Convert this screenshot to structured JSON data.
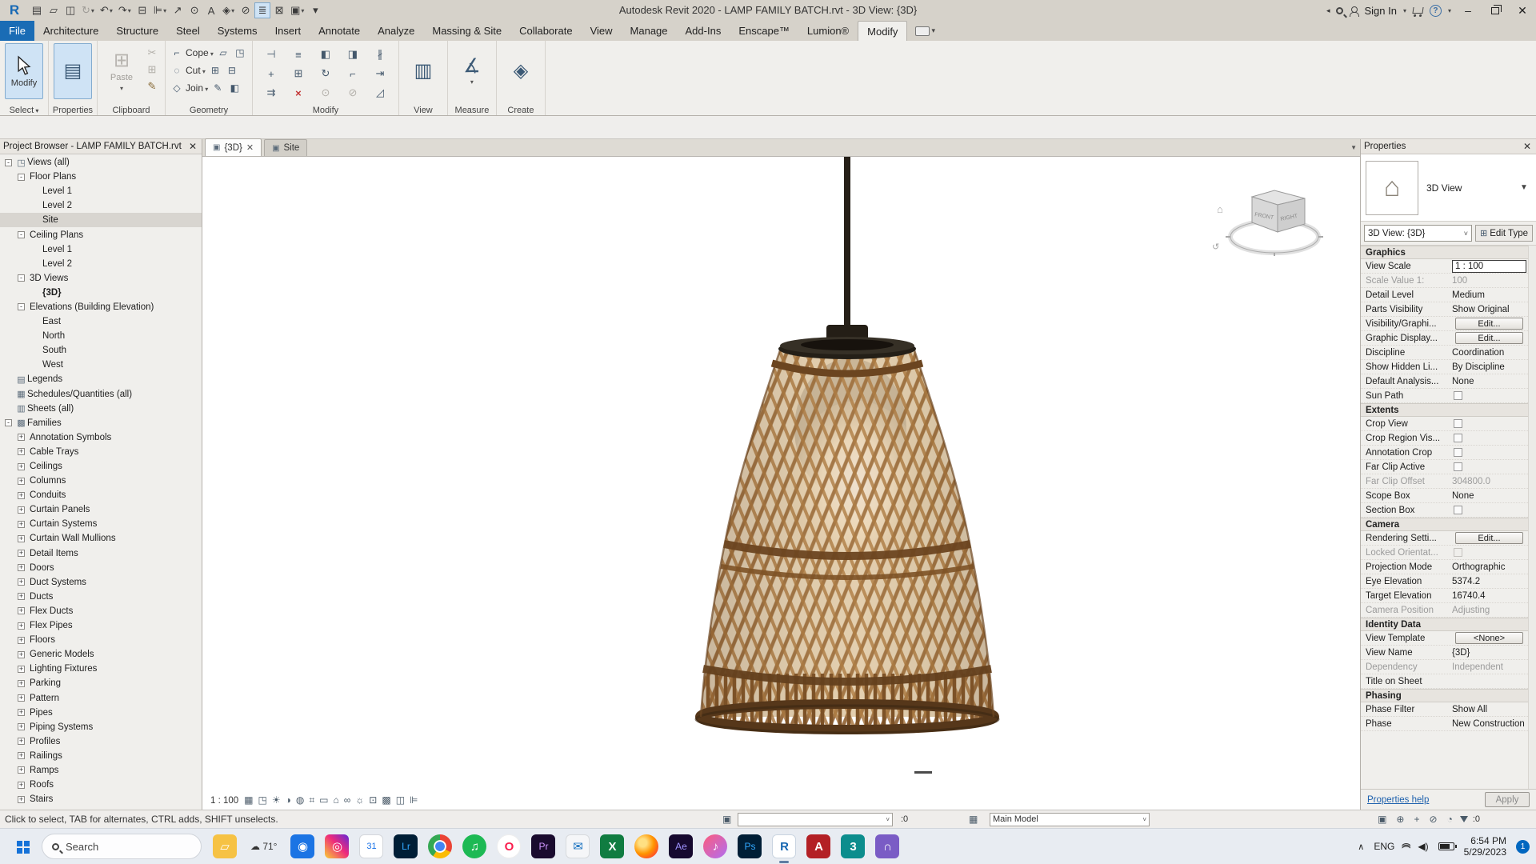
{
  "titlebar": {
    "title": "Autodesk Revit 2020 - LAMP FAMILY BATCH.rvt - 3D View: {3D}",
    "sign_in": "Sign In",
    "help_glyph": "?",
    "min_glyph": "–",
    "close_glyph": "✕",
    "overflow_glyph": "◂",
    "qat": [
      {
        "name": "app-menu-icon",
        "g": "▤"
      },
      {
        "name": "open-icon",
        "g": "▱"
      },
      {
        "name": "save-icon",
        "g": "◫"
      },
      {
        "name": "sync-with-central-icon",
        "g": "↻",
        "cls": "dd dim"
      },
      {
        "name": "undo-icon",
        "g": "↶",
        "cls": "dd"
      },
      {
        "name": "redo-icon",
        "g": "↷",
        "cls": "dd"
      },
      {
        "name": "print-icon",
        "g": "⊟"
      },
      {
        "name": "measure-icon",
        "g": "⊫",
        "cls": "dd"
      },
      {
        "name": "aligned-dimension-icon",
        "g": "↗"
      },
      {
        "name": "tag-icon",
        "g": "⊙"
      },
      {
        "name": "text-icon",
        "g": "A"
      },
      {
        "name": "default-3d-view-icon",
        "g": "◈",
        "cls": "dd"
      },
      {
        "name": "section-icon",
        "g": "⊘"
      },
      {
        "name": "thin-lines-icon",
        "g": "≣",
        "cls": "on"
      },
      {
        "name": "close-inactive-windows-icon",
        "g": "⊠"
      },
      {
        "name": "switch-windows-icon",
        "g": "▣",
        "cls": "dd"
      },
      {
        "name": "customize-qat-icon",
        "g": "▾"
      }
    ]
  },
  "ribbon": {
    "tabs": [
      {
        "label": "File",
        "cls": "file"
      },
      {
        "label": "Architecture"
      },
      {
        "label": "Structure"
      },
      {
        "label": "Steel"
      },
      {
        "label": "Systems"
      },
      {
        "label": "Insert"
      },
      {
        "label": "Annotate"
      },
      {
        "label": "Analyze"
      },
      {
        "label": "Massing & Site"
      },
      {
        "label": "Collaborate"
      },
      {
        "label": "View"
      },
      {
        "label": "Manage"
      },
      {
        "label": "Add-Ins"
      },
      {
        "label": "Enscape™"
      },
      {
        "label": "Lumion®"
      },
      {
        "label": "Modify",
        "cls": "active"
      }
    ],
    "panels": {
      "select": "Select",
      "properties": "Properties",
      "clipboard": "Clipboard",
      "geometry": "Geometry",
      "modify": "Modify",
      "view": "View",
      "measure": "Measure",
      "create": "Create"
    },
    "modify_button": "Modify",
    "paste_label": "Paste",
    "properties_icon": "▤",
    "view_icon": "▥",
    "measure_icon": "∡",
    "create_icon": "◈",
    "clipboard_icons": [
      {
        "name": "cut-icon",
        "g": "✂",
        "cls": "dim"
      },
      {
        "name": "copy-to-clipboard-icon",
        "g": "⊞",
        "cls": "dim"
      },
      {
        "name": "match-type-properties-icon",
        "g": "✎",
        "cls": "brown"
      }
    ],
    "geometry_rows": [
      {
        "name": "cope-button",
        "g": "⌐",
        "label": "Cope",
        "x1": "▱",
        "x2": "◳"
      },
      {
        "name": "cut-geometry-button",
        "g": "◌",
        "label": "Cut",
        "x1": "⊞",
        "x2": "⊟"
      },
      {
        "name": "join-geometry-button",
        "g": "◇",
        "label": "Join",
        "x1": "✎",
        "x2": "◧"
      }
    ],
    "modify_icons": [
      {
        "name": "align-icon",
        "g": "⊣"
      },
      {
        "name": "offset-icon",
        "g": "≡"
      },
      {
        "name": "mirror-pick-axis-icon",
        "g": "◧"
      },
      {
        "name": "mirror-draw-axis-icon",
        "g": "◨"
      },
      {
        "name": "split-element-icon",
        "g": "∦"
      },
      {
        "name": "move-icon",
        "g": "+"
      },
      {
        "name": "copy-icon",
        "g": "⊞"
      },
      {
        "name": "rotate-icon",
        "g": "↻"
      },
      {
        "name": "trim-corner-icon",
        "g": "⌐"
      },
      {
        "name": "trim-extend-single-icon",
        "g": "⇥"
      },
      {
        "name": "trim-extend-multiple-icon",
        "g": "⇉"
      },
      {
        "name": "delete-icon",
        "g": "×",
        "cls": "red"
      },
      {
        "name": "pin-icon",
        "g": "⊙",
        "cls": "dim"
      },
      {
        "name": "unpin-icon",
        "g": "⊘",
        "cls": "dim"
      },
      {
        "name": "scale-icon",
        "g": "◿"
      }
    ]
  },
  "browser": {
    "title": "Project Browser - LAMP FAMILY BATCH.rvt",
    "close_glyph": "✕",
    "tree": [
      {
        "label": "Views (all)",
        "lv": 0,
        "exp": "-",
        "ico": "◳"
      },
      {
        "label": "Floor Plans",
        "lv": 1,
        "exp": "-"
      },
      {
        "label": "Level 1",
        "lv": 2
      },
      {
        "label": "Level 2",
        "lv": 2
      },
      {
        "label": "Site",
        "lv": 2,
        "cls": "sel"
      },
      {
        "label": "Ceiling Plans",
        "lv": 1,
        "exp": "-"
      },
      {
        "label": "Level 1",
        "lv": 2
      },
      {
        "label": "Level 2",
        "lv": 2
      },
      {
        "label": "3D Views",
        "lv": 1,
        "exp": "-"
      },
      {
        "label": "{3D}",
        "lv": 2,
        "cls": "bold"
      },
      {
        "label": "Elevations (Building Elevation)",
        "lv": 1,
        "exp": "-"
      },
      {
        "label": "East",
        "lv": 2
      },
      {
        "label": "North",
        "lv": 2
      },
      {
        "label": "South",
        "lv": 2
      },
      {
        "label": "West",
        "lv": 2
      },
      {
        "label": "Legends",
        "lv": 0,
        "ico": "▤"
      },
      {
        "label": "Schedules/Quantities (all)",
        "lv": 0,
        "ico": "▦"
      },
      {
        "label": "Sheets (all)",
        "lv": 0,
        "ico": "▥"
      },
      {
        "label": "Families",
        "lv": 0,
        "exp": "-",
        "ico": "▩"
      },
      {
        "label": "Annotation Symbols",
        "lv": 1,
        "exp": "+"
      },
      {
        "label": "Cable Trays",
        "lv": 1,
        "exp": "+"
      },
      {
        "label": "Ceilings",
        "lv": 1,
        "exp": "+"
      },
      {
        "label": "Columns",
        "lv": 1,
        "exp": "+"
      },
      {
        "label": "Conduits",
        "lv": 1,
        "exp": "+"
      },
      {
        "label": "Curtain Panels",
        "lv": 1,
        "exp": "+"
      },
      {
        "label": "Curtain Systems",
        "lv": 1,
        "exp": "+"
      },
      {
        "label": "Curtain Wall Mullions",
        "lv": 1,
        "exp": "+"
      },
      {
        "label": "Detail Items",
        "lv": 1,
        "exp": "+"
      },
      {
        "label": "Doors",
        "lv": 1,
        "exp": "+"
      },
      {
        "label": "Duct Systems",
        "lv": 1,
        "exp": "+"
      },
      {
        "label": "Ducts",
        "lv": 1,
        "exp": "+"
      },
      {
        "label": "Flex Ducts",
        "lv": 1,
        "exp": "+"
      },
      {
        "label": "Flex Pipes",
        "lv": 1,
        "exp": "+"
      },
      {
        "label": "Floors",
        "lv": 1,
        "exp": "+"
      },
      {
        "label": "Generic Models",
        "lv": 1,
        "exp": "+"
      },
      {
        "label": "Lighting Fixtures",
        "lv": 1,
        "exp": "+"
      },
      {
        "label": "Parking",
        "lv": 1,
        "exp": "+"
      },
      {
        "label": "Pattern",
        "lv": 1,
        "exp": "+"
      },
      {
        "label": "Pipes",
        "lv": 1,
        "exp": "+"
      },
      {
        "label": "Piping Systems",
        "lv": 1,
        "exp": "+"
      },
      {
        "label": "Profiles",
        "lv": 1,
        "exp": "+"
      },
      {
        "label": "Railings",
        "lv": 1,
        "exp": "+"
      },
      {
        "label": "Ramps",
        "lv": 1,
        "exp": "+"
      },
      {
        "label": "Roofs",
        "lv": 1,
        "exp": "+"
      },
      {
        "label": "Stairs",
        "lv": 1,
        "exp": "+"
      }
    ]
  },
  "view_tabs": {
    "tabs": [
      {
        "label": "{3D}",
        "cls": "active",
        "x": "✕",
        "ico": "▣"
      },
      {
        "label": "Site",
        "ico": "▣"
      }
    ],
    "list_icon": "▼"
  },
  "properties": {
    "title": "Properties",
    "close_glyph": "✕",
    "preview_icon": "⌂",
    "view_type": "3D View",
    "type_selector": "3D View: {3D}",
    "edit_type": "Edit Type",
    "edit_type_icon": "⊞",
    "rows": [
      {
        "label": "Graphics",
        "cls": "sec"
      },
      {
        "label": "View Scale",
        "value": "1 : 100",
        "cls": "input"
      },
      {
        "label": "Scale Value    1:",
        "value": "100",
        "cls": "dis"
      },
      {
        "label": "Detail Level",
        "value": "Medium"
      },
      {
        "label": "Parts Visibility",
        "value": "Show Original"
      },
      {
        "label": "Visibility/Graphi...",
        "value": "Edit...",
        "cls": "btn"
      },
      {
        "label": "Graphic Display...",
        "value": "Edit...",
        "cls": "btn"
      },
      {
        "label": "Discipline",
        "value": "Coordination"
      },
      {
        "label": "Show Hidden Li...",
        "value": "By Discipline"
      },
      {
        "label": "Default Analysis...",
        "value": "None"
      },
      {
        "label": "Sun Path",
        "cls": "check"
      },
      {
        "label": "Extents",
        "cls": "sec"
      },
      {
        "label": "Crop View",
        "cls": "check"
      },
      {
        "label": "Crop Region Vis...",
        "cls": "check"
      },
      {
        "label": "Annotation Crop",
        "cls": "check"
      },
      {
        "label": "Far Clip Active",
        "cls": "check"
      },
      {
        "label": "Far Clip Offset",
        "value": "304800.0",
        "cls": "dis"
      },
      {
        "label": "Scope Box",
        "value": "None"
      },
      {
        "label": "Section Box",
        "cls": "check"
      },
      {
        "label": "Camera",
        "cls": "sec"
      },
      {
        "label": "Rendering Setti...",
        "value": "Edit...",
        "cls": "btn"
      },
      {
        "label": "Locked Orientat...",
        "cls": "check dis"
      },
      {
        "label": "Projection Mode",
        "value": "Orthographic"
      },
      {
        "label": "Eye Elevation",
        "value": "5374.2"
      },
      {
        "label": "Target Elevation",
        "value": "16740.4"
      },
      {
        "label": "Camera Position",
        "value": "Adjusting",
        "cls": "dis"
      },
      {
        "label": "Identity Data",
        "cls": "sec"
      },
      {
        "label": "View Template",
        "value": "<None>",
        "cls": "btn"
      },
      {
        "label": "View Name",
        "value": "{3D}"
      },
      {
        "label": "Dependency",
        "value": "Independent",
        "cls": "dis"
      },
      {
        "label": "Title on Sheet",
        "value": ""
      },
      {
        "label": "Phasing",
        "cls": "sec"
      },
      {
        "label": "Phase Filter",
        "value": "Show All"
      },
      {
        "label": "Phase",
        "value": "New Construction"
      }
    ],
    "help": "Properties help",
    "apply": "Apply"
  },
  "viewbar": {
    "scale": "1 : 100",
    "icons": [
      {
        "name": "visual-style-icon",
        "g": "▦"
      },
      {
        "name": "detail-level-icon",
        "g": "◳"
      },
      {
        "name": "sun-path-icon",
        "g": "☀"
      },
      {
        "name": "shadows-icon",
        "g": "◑"
      },
      {
        "name": "render-dialog-icon",
        "g": "◍"
      },
      {
        "name": "crop-view-icon",
        "g": "⌗"
      },
      {
        "name": "show-crop-region-icon",
        "g": "▭"
      },
      {
        "name": "locked-3d-view-icon",
        "g": "⌂"
      },
      {
        "name": "reveal-hidden-elements-icon",
        "g": "∞"
      },
      {
        "name": "temporary-hide-isolate-icon",
        "g": "☼"
      },
      {
        "name": "temporary-view-properties-icon",
        "g": "⊡"
      },
      {
        "name": "worksharing-display-icon",
        "g": "▩"
      },
      {
        "name": "displaced-elements-icon",
        "g": "◫"
      },
      {
        "name": "measure-constraints-icon",
        "g": "⊫"
      }
    ]
  },
  "statusbar": {
    "hint": "Click to select, TAB for alternates, CTRL adds, SHIFT unselects.",
    "workset_icon": "▣",
    "requests": ":0",
    "design_icon": "▦",
    "main_model": "Main Model",
    "right_icons": [
      {
        "name": "editable-only-icon",
        "g": "▣"
      },
      {
        "name": "links-icon",
        "g": "⊕"
      },
      {
        "name": "press-drag-icon",
        "g": "+"
      },
      {
        "name": "exclude-options-icon",
        "g": "⊘"
      },
      {
        "name": "background-processes-icon",
        "g": "◔"
      }
    ],
    "filter_count": ":0"
  },
  "canvas": {
    "viewcube_front": "FRONT",
    "viewcube_right": "RIGHT"
  },
  "taskbar": {
    "search": "Search",
    "lang": "ENG",
    "time": "6:54 PM",
    "date": "5/29/2023",
    "badge": "1",
    "apps": [
      {
        "name": "file-explorer-icon",
        "g": "▱",
        "style": "background:#f6c244;color:#fff"
      },
      {
        "name": "weather-widget",
        "g": "☁ 71°",
        "style": "background:transparent;color:#333;font-size:12px;width:auto;padding:0 4px"
      },
      {
        "name": "camera-app-icon",
        "g": "◉",
        "style": "background:#1b74e4;color:#fff"
      },
      {
        "name": "instagram-icon",
        "g": "◎",
        "style": "background:linear-gradient(45deg,#f9ce34,#ee2a7b 55%,#6228d7);color:#fff"
      },
      {
        "name": "calendar-app-icon",
        "g": "31",
        "style": "background:#fff;color:#1a73e8;font-size:11px;border:1px solid #d4d7dc"
      },
      {
        "name": "lightroom-icon",
        "g": "Lr",
        "style": "background:#001e36;color:#31a8ff;font-size:12px"
      },
      {
        "name": "chrome-icon",
        "g": "",
        "style": "background:radial-gradient(circle,#4285f4 0 27%,#fff 29% 36%,transparent 38%),conic-gradient(#ea4335 0 33%,#fbbc05 33% 60%,#34a853 60% 100%);border-radius:50%"
      },
      {
        "name": "spotify-icon",
        "g": "♫",
        "style": "background:#1db954;color:#fff;border-radius:50%"
      },
      {
        "name": "opera-icon",
        "g": "O",
        "style": "background:#fff;color:#fa1e4e;font-weight:bold;border-radius:50%;border:1px solid #eee"
      },
      {
        "name": "premiere-icon",
        "g": "Pr",
        "style": "background:#1a0b2e;color:#cf96fd;font-size:12px"
      },
      {
        "name": "mail-app-icon",
        "g": "✉",
        "style": "background:#f5f6f8;color:#0f6cbd;border:1px solid #d8dadd"
      },
      {
        "name": "excel-icon",
        "g": "X",
        "style": "background:#107c41;color:#fff;font-weight:bold"
      },
      {
        "name": "firefox-icon",
        "g": "",
        "style": "background:radial-gradient(circle at 35% 35%,#ffe082 0 18%,#ff9500 50%,#ff3b30 85%);border-radius:50%"
      },
      {
        "name": "after-effects-icon",
        "g": "Ae",
        "style": "background:#16092f;color:#9f93ff;font-size:12px"
      },
      {
        "name": "music-app-icon",
        "g": "♪",
        "style": "background:linear-gradient(135deg,#fc5c7d,#b06ef2);color:#fff;border-radius:50%"
      },
      {
        "name": "photoshop-icon",
        "g": "Ps",
        "style": "background:#001e36;color:#31a8ff;font-size:12px"
      },
      {
        "name": "revit-icon",
        "g": "R",
        "style": "background:#fff;color:#1666b0;font-weight:bold",
        "cls": "active"
      },
      {
        "name": "autocad-icon",
        "g": "A",
        "style": "background:#b32025;color:#fff;font-weight:bold"
      },
      {
        "name": "3ds-max-icon",
        "g": "3",
        "style": "background:#0c8d8d;color:#fff;font-weight:bold"
      },
      {
        "name": "headphones-icon",
        "g": "∩",
        "style": "background:#7a5cc5;color:#fff;font-weight:bold"
      }
    ]
  }
}
